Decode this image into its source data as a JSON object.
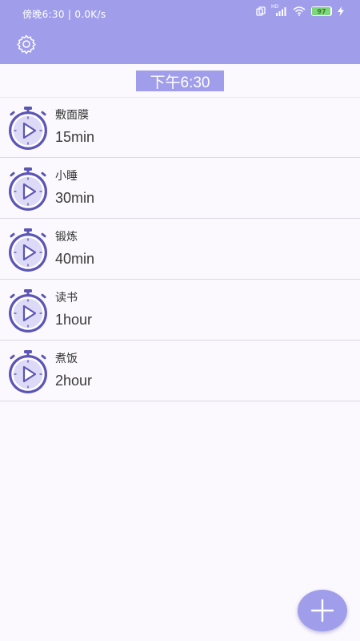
{
  "status_bar": {
    "left_text": "傍晚6:30 | 0.0K/s",
    "battery": "97",
    "battery_percent": 97,
    "icons": [
      "dual-sim-icon",
      "signal-icon",
      "wifi-icon",
      "battery-icon",
      "charging-icon"
    ],
    "network_label": "HD"
  },
  "header": {
    "settings_icon": "gear-icon"
  },
  "clock": {
    "time": "下午6:30"
  },
  "tasks": [
    {
      "name": "敷面膜",
      "duration": "15min",
      "icon": "timer-play-icon"
    },
    {
      "name": "小睡",
      "duration": "30min",
      "icon": "timer-play-icon"
    },
    {
      "name": "锻炼",
      "duration": "40min",
      "icon": "timer-play-icon"
    },
    {
      "name": "读书",
      "duration": "1hour",
      "icon": "timer-play-icon"
    },
    {
      "name": "煮饭",
      "duration": "2hour",
      "icon": "timer-play-icon"
    }
  ],
  "fab": {
    "icon": "plus-icon"
  },
  "colors": {
    "accent": "#a09eeb",
    "background": "#fbf9fd",
    "timer_ring": "#5b55b5",
    "timer_face": "#dcdaf7"
  }
}
